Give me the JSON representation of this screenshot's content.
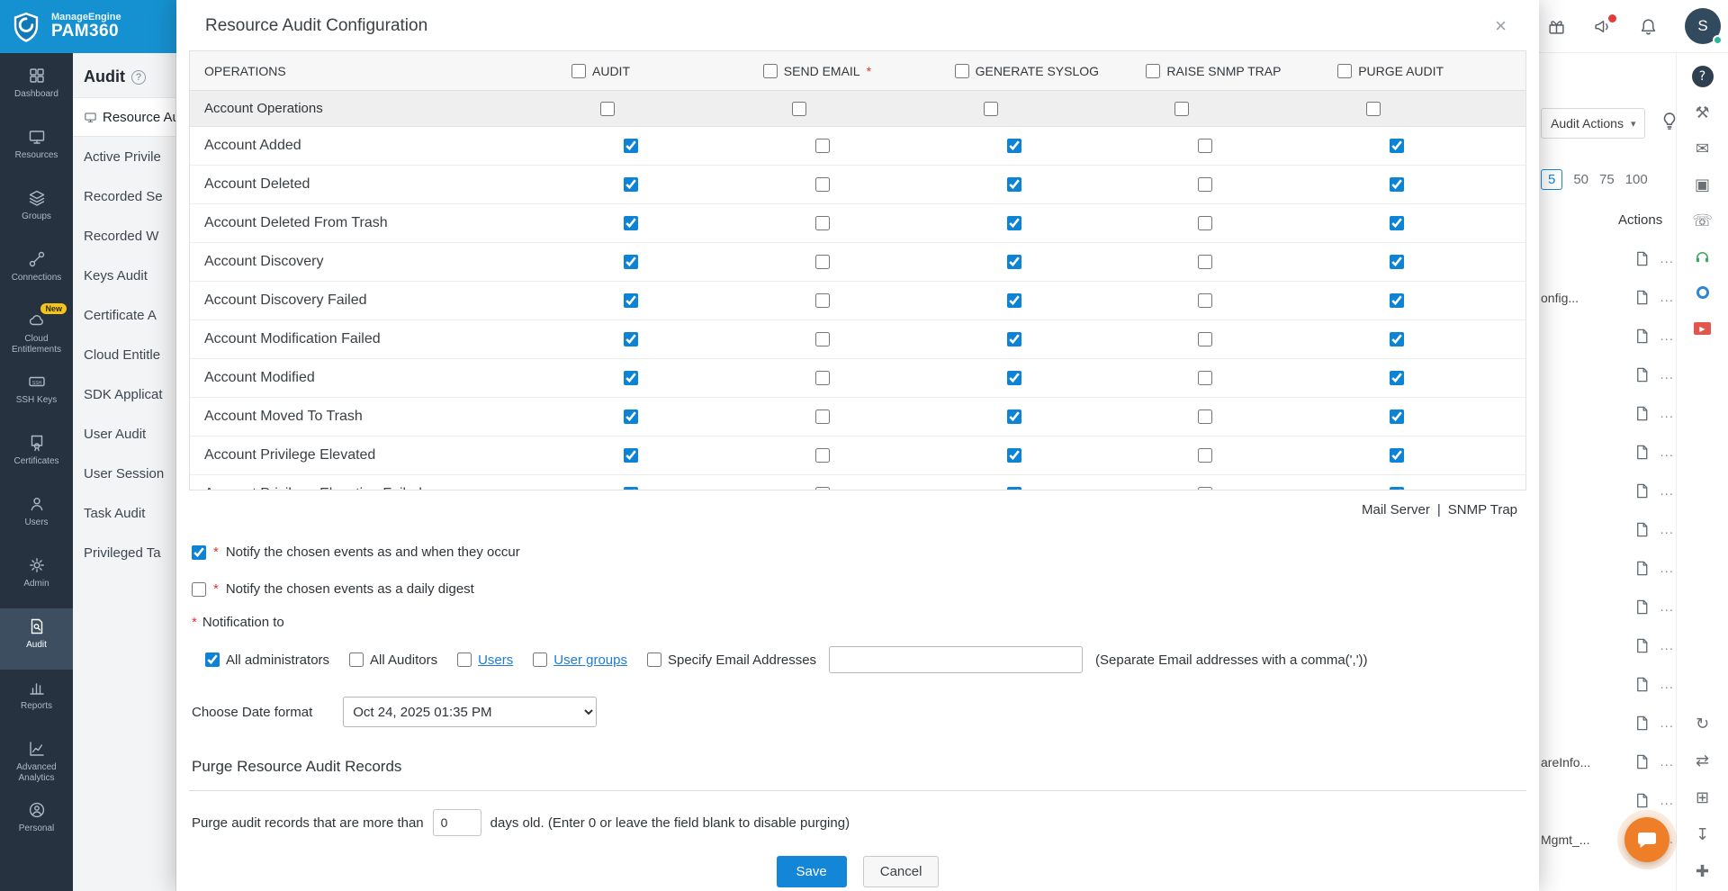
{
  "colors": {
    "brand_blue": "#1591d1",
    "sidebar_dark": "#273240",
    "accent_blue": "#1486d8",
    "checkbox_blue": "#0d83d6",
    "badge_yellow": "#f3c51a",
    "link_blue": "#1f7ad4",
    "required_red": "#e53333",
    "headset_green": "#3fa65c",
    "video_red": "#e2574c",
    "fab_orange": "#ef7e28"
  },
  "brand": {
    "line1": "ManageEngine",
    "line2": "PAM360",
    "logo_icon": "pam360-shield-icon"
  },
  "sidebar": {
    "items": [
      {
        "label": "Dashboard",
        "icon": "dashboard-icon"
      },
      {
        "label": "Resources",
        "icon": "resources-icon"
      },
      {
        "label": "Groups",
        "icon": "groups-icon"
      },
      {
        "label": "Connections",
        "icon": "connections-icon"
      },
      {
        "label": "Cloud Entitlements",
        "icon": "cloud-entitlements-icon",
        "badge": "New"
      },
      {
        "label": "SSH Keys",
        "icon": "ssh-keys-icon"
      },
      {
        "label": "Certificates",
        "icon": "certificates-icon"
      },
      {
        "label": "Users",
        "icon": "users-icon"
      },
      {
        "label": "Admin",
        "icon": "admin-icon"
      },
      {
        "label": "Audit",
        "icon": "audit-icon",
        "active": true
      },
      {
        "label": "Reports",
        "icon": "reports-icon"
      },
      {
        "label": "Advanced Analytics",
        "icon": "advanced-analytics-icon"
      },
      {
        "label": "Personal",
        "icon": "personal-icon"
      }
    ]
  },
  "audit_menu": {
    "title": "Audit",
    "help_mark": "?",
    "items": [
      {
        "label": "Resource Au",
        "icon": "resource-audit-icon",
        "active": true
      },
      {
        "label": "Active Privile"
      },
      {
        "label": "Recorded Se"
      },
      {
        "label": "Recorded W"
      },
      {
        "label": "Keys Audit"
      },
      {
        "label": "Certificate A"
      },
      {
        "label": "Cloud Entitle"
      },
      {
        "label": "SDK Applicat"
      },
      {
        "label": "User Audit"
      },
      {
        "label": "User Session"
      },
      {
        "label": "Task Audit"
      },
      {
        "label": "Privileged Ta"
      }
    ]
  },
  "background": {
    "topbar": {
      "gift_icon": "gift-icon",
      "announce_icon": "announcement-icon",
      "bell_icon": "bell-icon",
      "avatar_text": "S"
    },
    "audit_actions_label": "Audit Actions",
    "audit_actions_caret": "▾",
    "bulb_icon": "bulb-icon",
    "page_sizes": [
      {
        "label": "5",
        "active": true
      },
      {
        "label": "50"
      },
      {
        "label": "75"
      },
      {
        "label": "100"
      }
    ],
    "actions_header": "Actions",
    "row_icon": "document-icon",
    "row_more": "...",
    "rows": [
      "",
      "onfig...",
      "",
      "",
      "",
      "",
      "",
      "",
      "",
      "",
      "",
      "",
      "",
      "areInfo...",
      "",
      "Mgmt_..."
    ]
  },
  "strip": {
    "top": [
      "help-icon",
      "wrench-icon",
      "mail-icon",
      "copy-icon",
      "phone-icon",
      "headset-icon",
      "swirl-icon",
      "video-icon"
    ],
    "bottom": [
      "history-icon",
      "swap-icon",
      "apps-icon",
      "download-icon",
      "plus-icon"
    ]
  },
  "fab": {
    "icon": "chat-icon"
  },
  "modal": {
    "title": "Resource Audit Configuration",
    "close_icon": "×",
    "required_mark": "*",
    "table": {
      "operations_header": "OPERATIONS",
      "columns": [
        {
          "label": "AUDIT",
          "checked": false
        },
        {
          "label": "SEND EMAIL",
          "checked": false,
          "required": true
        },
        {
          "label": "GENERATE SYSLOG",
          "checked": false
        },
        {
          "label": "RAISE SNMP TRAP",
          "checked": false
        },
        {
          "label": "PURGE AUDIT",
          "checked": false
        }
      ],
      "group_label": "Account Operations",
      "group_checks": [
        false,
        false,
        false,
        false,
        false
      ],
      "rows": [
        {
          "label": "Account Added",
          "checks": [
            true,
            false,
            true,
            false,
            true
          ]
        },
        {
          "label": "Account Deleted",
          "checks": [
            true,
            false,
            true,
            false,
            true
          ]
        },
        {
          "label": "Account Deleted From Trash",
          "checks": [
            true,
            false,
            true,
            false,
            true
          ]
        },
        {
          "label": "Account Discovery",
          "checks": [
            true,
            false,
            true,
            false,
            true
          ]
        },
        {
          "label": "Account Discovery Failed",
          "checks": [
            true,
            false,
            true,
            false,
            true
          ]
        },
        {
          "label": "Account Modification Failed",
          "checks": [
            true,
            false,
            true,
            false,
            true
          ]
        },
        {
          "label": "Account Modified",
          "checks": [
            true,
            false,
            true,
            false,
            true
          ]
        },
        {
          "label": "Account Moved To Trash",
          "checks": [
            true,
            false,
            true,
            false,
            true
          ]
        },
        {
          "label": "Account Privilege Elevated",
          "checks": [
            true,
            false,
            true,
            false,
            true
          ]
        },
        {
          "label": "Account Privilege Elevation Failed",
          "checks": [
            true,
            false,
            true,
            false,
            true
          ]
        }
      ]
    },
    "links": {
      "mail_server": "Mail Server",
      "separator": "|",
      "snmp_trap": "SNMP Trap"
    },
    "notify": [
      {
        "checked": true,
        "label": "Notify the chosen events as and when they occur"
      },
      {
        "checked": false,
        "label": "Notify the chosen events as a daily digest"
      }
    ],
    "notification_to_label": "Notification to",
    "recipients": [
      {
        "checked": true,
        "label": "All administrators"
      },
      {
        "checked": false,
        "label": "All Auditors"
      },
      {
        "checked": false,
        "label": "Users",
        "link": true
      },
      {
        "checked": false,
        "label": "User groups",
        "link": true
      },
      {
        "checked": false,
        "label": "Specify Email Addresses"
      }
    ],
    "email_value": "",
    "email_hint": "(Separate Email addresses with a comma(','))",
    "date_format_label": "Choose Date format",
    "date_format_value": "Oct 24, 2025 01:35 PM",
    "purge_section_title": "Purge Resource Audit Records",
    "purge_text_before": "Purge audit records that are more than",
    "purge_value": "0",
    "purge_text_after": "days old. (Enter 0 or leave the field blank to disable purging)",
    "save_label": "Save",
    "cancel_label": "Cancel"
  }
}
